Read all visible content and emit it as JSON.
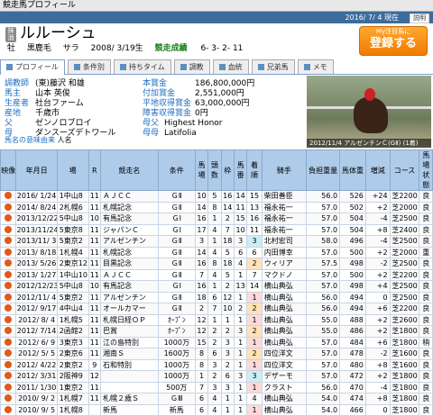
{
  "window": {
    "title": "競走馬プロフィール",
    "date": "2016/ 7/ 4 現在",
    "help": "説明"
  },
  "horse": {
    "badge": "抹消",
    "name": "ルルーシュ",
    "sex_age": "牡",
    "color": "黒鹿毛",
    "breed": "サラ",
    "birth": "2008/ 3/19生",
    "record_label": "競走成績",
    "record": "6- 3- 2- 11"
  },
  "register_button": {
    "small": "My注目馬に",
    "big": "登録する"
  },
  "tabs": [
    "プロフィール",
    "条件別",
    "持ちタイム",
    "調教",
    "血統",
    "兄弟馬",
    "メモ"
  ],
  "profile": {
    "trainer_label": "調教師",
    "trainer": "(東)藤沢 和雄",
    "owner_label": "馬主",
    "owner": "山本 英俊",
    "breeder_label": "生産者",
    "breeder": "社台ファーム",
    "origin_label": "産地",
    "origin": "千歳市",
    "sire_label": "父",
    "sire": "ゼンノロブロイ",
    "dam_label": "母",
    "dam": "ダンスーズデトワール",
    "prize_label": "本賞金",
    "prize": "186,800,000円",
    "add_prize_label": "付加賞金",
    "add_prize": "2,551,000円",
    "avg_prize_label": "平地収得賞金",
    "avg_prize": "63,000,000円",
    "jump_prize_label": "障害収得賞金",
    "jump_prize": "0円",
    "bms_label": "母父",
    "bms": "Highest Honor",
    "damdam_label": "母母",
    "damdam": "Latifolia",
    "meaning_label": "馬名の意味由来",
    "meaning": "人名",
    "photo_caption": "2012/11/4 アルゼンチンＣ(GⅡ) (1着)"
  },
  "table": {
    "headers": [
      "映像",
      "年月日",
      "場",
      "R",
      "競走名",
      "条件",
      "馬場",
      "頭数",
      "枠",
      "馬番",
      "人気",
      "着順",
      "騎手",
      "負担重量",
      "馬体重",
      "増減",
      "コース",
      "馬場状態"
    ],
    "header_short": [
      "映像",
      "年月日",
      "場",
      "",
      "R",
      "競走名",
      "条件",
      "馬",
      "頭",
      "枠",
      "番",
      "人",
      "着順",
      "騎手",
      "負担重量",
      "馬体重",
      "増減",
      "コース",
      "良"
    ],
    "rows": [
      [
        "2016/ 1/24",
        "1中山8",
        "11",
        "ＡＪＣＣ",
        "ＧⅡ",
        "10",
        "5",
        "16",
        "14",
        "15",
        "柴田善臣",
        "56.0",
        "526",
        "+24",
        "芝2200",
        "良"
      ],
      [
        "2014/ 8/24",
        "2札幌6",
        "11",
        "札幌記念",
        "ＧⅡ",
        "14",
        "8",
        "14",
        "11",
        "13",
        "福永祐一",
        "57.0",
        "502",
        "+2",
        "芝2000",
        "良"
      ],
      [
        "2013/12/22",
        "5中山8",
        "10",
        "有馬記念",
        "ＧⅠ",
        "16",
        "1",
        "2",
        "15",
        "16",
        "福永祐一",
        "57.0",
        "504",
        "-4",
        "芝2500",
        "良"
      ],
      [
        "2013/11/24",
        "5東京8",
        "11",
        "ジャパンＣ",
        "ＧⅠ",
        "17",
        "4",
        "7",
        "10",
        "11",
        "福永祐一",
        "57.0",
        "504",
        "+8",
        "芝2400",
        "良"
      ],
      [
        "2013/11/ 3",
        "5東京2",
        "11",
        "アルゼンチン",
        "ＧⅡ",
        "3",
        "1",
        "18",
        "3",
        "3",
        "北村宏司",
        "58.0",
        "496",
        "-4",
        "芝2500",
        "良"
      ],
      [
        "2013/ 8/18",
        "1札幌4",
        "11",
        "札幌記念",
        "ＧⅡ",
        "14",
        "4",
        "5",
        "6",
        "6",
        "内田博幸",
        "57.0",
        "500",
        "+2",
        "芝2000",
        "重"
      ],
      [
        "2013/ 5/26",
        "2東京12",
        "11",
        "目黒記念",
        "ＧⅡ",
        "16",
        "8",
        "18",
        "4",
        "2",
        "ウィリア",
        "57.5",
        "498",
        "-2",
        "芝2500",
        "良"
      ],
      [
        "2013/ 1/27",
        "1中山10",
        "11",
        "ＡＪＣＣ",
        "ＧⅡ",
        "7",
        "4",
        "5",
        "1",
        "7",
        "マクドノ",
        "57.0",
        "500",
        "+2",
        "芝2200",
        "良"
      ],
      [
        "2012/12/23",
        "5中山8",
        "10",
        "有馬記念",
        "ＧⅠ",
        "16",
        "1",
        "2",
        "13",
        "14",
        "横山典弘",
        "57.0",
        "498",
        "+4",
        "芝2500",
        "良"
      ],
      [
        "2012/11/ 4",
        "5東京2",
        "11",
        "アルゼンチン",
        "ＧⅡ",
        "18",
        "6",
        "12",
        "1",
        "1",
        "横山典弘",
        "56.0",
        "494",
        "0",
        "芝2500",
        "良"
      ],
      [
        "2012/ 9/17",
        "4中山4",
        "11",
        "オールカマー",
        "ＧⅡ",
        "2",
        "7",
        "10",
        "2",
        "2",
        "横山典弘",
        "56.0",
        "494",
        "+6",
        "芝2200",
        "良"
      ],
      [
        "2012/ 8/ 4",
        "1札幌5",
        "11",
        "札幌日経ＯＰ",
        "ｵｰﾌﾟﾝ",
        "12",
        "1",
        "1",
        "1",
        "1",
        "横山典弘",
        "55.0",
        "488",
        "+2",
        "芝2600",
        "良"
      ],
      [
        "2012/ 7/14",
        "2函館2",
        "11",
        "巴賞",
        "ｵｰﾌﾟﾝ",
        "12",
        "2",
        "2",
        "3",
        "2",
        "横山典弘",
        "55.0",
        "486",
        "+2",
        "芝1800",
        "良"
      ],
      [
        "2012/ 6/ 9",
        "3東京3",
        "11",
        "江の島特別",
        "1000万",
        "15",
        "2",
        "3",
        "1",
        "1",
        "横山典弘",
        "57.0",
        "484",
        "+6",
        "芝1800",
        "稍"
      ],
      [
        "2012/ 5/ 5",
        "2東京6",
        "11",
        "湘南Ｓ",
        "1600万",
        "8",
        "6",
        "3",
        "1",
        "2",
        "四位洋文",
        "57.0",
        "478",
        "-2",
        "芝1600",
        "良"
      ],
      [
        "2012/ 4/22",
        "2東京2",
        "9",
        "石和特別",
        "1000万",
        "8",
        "3",
        "2",
        "1",
        "1",
        "四位洋文",
        "57.0",
        "480",
        "+8",
        "芝1600",
        "良"
      ],
      [
        "2012/ 3/31",
        "2阪神9",
        "12",
        "",
        "1000万",
        "1",
        "2",
        "6",
        "3",
        "3",
        "デザーモ",
        "57.0",
        "472",
        "+2",
        "芝1800",
        "良"
      ],
      [
        "2011/ 1/30",
        "1東京2",
        "11",
        "",
        "500万",
        "7",
        "3",
        "3",
        "1",
        "1",
        "クラスト",
        "56.0",
        "470",
        "-4",
        "芝1800",
        "良"
      ],
      [
        "2010/ 9/ 2",
        "1札幌7",
        "11",
        "札幌２歳Ｓ",
        "ＧⅢ",
        "6",
        "4",
        "1",
        "1",
        "4",
        "横山典弘",
        "54.0",
        "474",
        "+8",
        "芝1800",
        "良"
      ],
      [
        "2010/ 9/ 5",
        "1札幌8",
        "",
        "新馬",
        "新馬",
        "6",
        "4",
        "1",
        "1",
        "1",
        "横山典弘",
        "54.0",
        "466",
        "0",
        "芝1800",
        "良"
      ]
    ]
  }
}
